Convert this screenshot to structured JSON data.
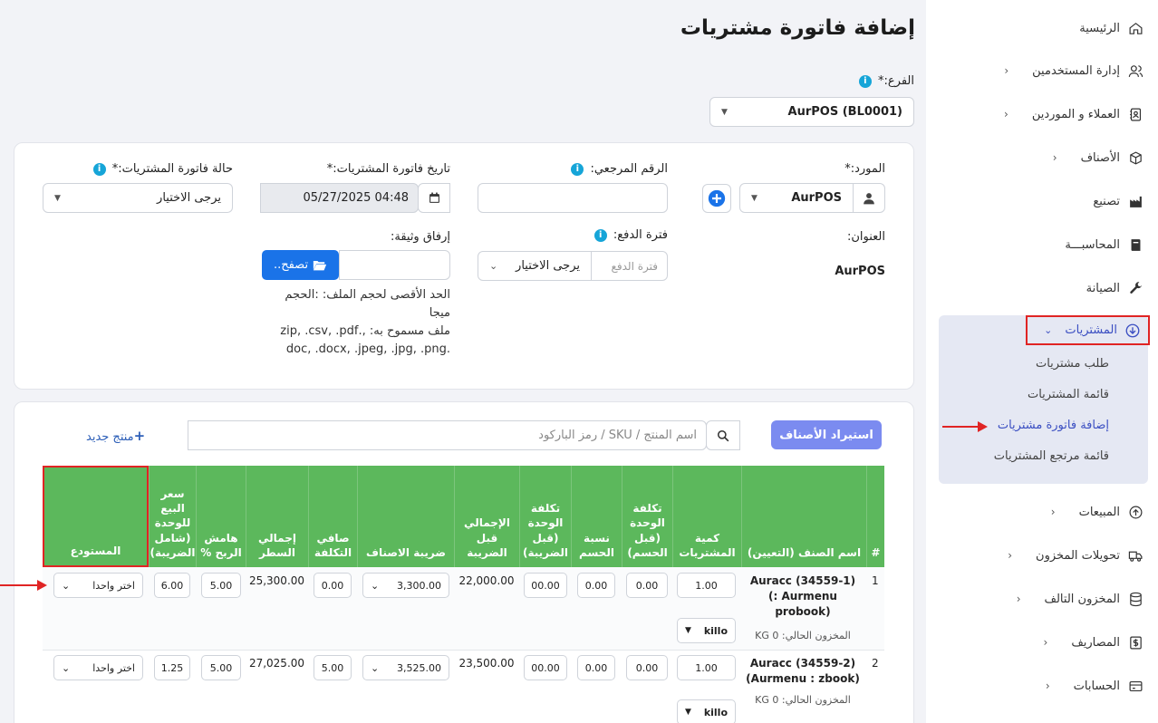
{
  "page": {
    "title": "إضافة فاتورة مشتريات"
  },
  "sidebar": {
    "items": [
      {
        "label": "الرئيسية",
        "icon": "home-icon",
        "chevron": false
      },
      {
        "label": "إدارة المستخدمين",
        "icon": "users-icon",
        "chevron": true
      },
      {
        "label": "العملاء و الموردين",
        "icon": "address-book-icon",
        "chevron": true
      },
      {
        "label": "الأصناف",
        "icon": "box-icon",
        "chevron": true
      },
      {
        "label": "تصنيع",
        "icon": "factory-icon",
        "chevron": false
      },
      {
        "label": "المحاسبـــة",
        "icon": "book-icon",
        "chevron": false
      },
      {
        "label": "الصيانة",
        "icon": "wrench-icon",
        "chevron": false
      }
    ],
    "active": {
      "label": "المشتريات",
      "icon": "download-icon"
    },
    "sub_items": [
      "طلب مشتريات",
      "قائمة المشتريات",
      "إضافة فاتورة مشتريات",
      "قائمة مرتجع المشتريات"
    ],
    "lower_items": [
      {
        "label": "المبيعات",
        "icon": "upload-icon"
      },
      {
        "label": "تحويلات المخزون",
        "icon": "truck-icon"
      },
      {
        "label": "المخزون التالف",
        "icon": "database-icon"
      },
      {
        "label": "المصاريف",
        "icon": "dollar-icon"
      },
      {
        "label": "الحسابات",
        "icon": "wallet-icon"
      }
    ]
  },
  "branch": {
    "label": "الفرع:*",
    "value": "AurPOS (BL0001)"
  },
  "form": {
    "supplier_label": "المورد:*",
    "supplier_value": "AurPOS",
    "reference_label": "الرقم المرجعي:",
    "date_label": "تاريخ فاتورة المشتريات:*",
    "date_value": "05/27/2025 04:48",
    "status_label": "حالة فاتورة المشتريات:*",
    "status_value": "يرجى الاختيار",
    "address_label": "العنوان:",
    "address_value": "AurPOS",
    "payment_term_label": "فترة الدفع:",
    "payment_term_placeholder": "فترة الدفع",
    "payment_term_select": "يرجى الاختيار",
    "attach_label": "إرفاق وثيقة:",
    "browse_label": "تصفح..",
    "file_note_1": "الحد الأقصى لحجم الملف: :الحجم",
    "file_note_2": "ميجا",
    "file_note_3": "ملف مسموح به: ,.zip, .csv, .pdf",
    "file_note_4": ".doc, .docx, .jpeg, .jpg, .png"
  },
  "products": {
    "import_label": "استيراد الأصناف",
    "search_placeholder": "اسم المنتج / SKU / رمز الباركود",
    "new_product_label": "منتج جديد"
  },
  "table": {
    "headers": {
      "num": "#",
      "name": "اسم الصنف (التعيين)",
      "qty": "كمية المشتريات",
      "unit_cost_before_disc": "تكلفة الوحدة (قبل الحسم)",
      "discount": "نسبة الحسم",
      "unit_cost_before_tax": "تكلفة الوحدة (قبل الضريبة)",
      "total_before_tax": "الإجمالي قبل الضريبة",
      "tax": "ضريبة الاصناف",
      "net_cost": "صافي التكلفة",
      "line_total": "إجمالي السطر",
      "margin": "هامش الربح %",
      "sell_price": "سعر البيع للوحدة (شامل الضريبة)",
      "warehouse": "المستودع"
    },
    "rows": [
      {
        "num": "1",
        "name_lines": [
          "Auracc (34559-1)",
          "Aurmenu :)",
          "(probook"
        ],
        "stock": "المخزون الحالي: KG 0",
        "qty": "1.00",
        "unit": "killo",
        "unit_cost": "0.00",
        "discount": "0.00",
        "unit_cost_before_tax": "00.00",
        "total_before_tax": "22,000.00",
        "tax": "3,300.00",
        "net_cost": "0.00",
        "line_total": "25,300.00",
        "margin": "5.00",
        "sell_price": "6.00",
        "warehouse": "اختر واحدا"
      },
      {
        "num": "2",
        "name_lines": [
          "Auracc (34559-2)",
          "(Aurmenu : zbook)"
        ],
        "stock": "المخزون الحالي: KG 0",
        "qty": "1.00",
        "unit": "killo",
        "unit_cost": "0.00",
        "discount": "0.00",
        "unit_cost_before_tax": "00.00",
        "total_before_tax": "23,500.00",
        "tax": "3,525.00",
        "net_cost": "5.00",
        "line_total": "27,025.00",
        "margin": "5.00",
        "sell_price": "1.25",
        "warehouse": "اختر واحدا"
      }
    ]
  },
  "colors": {
    "accent": "#3b4fc2",
    "table_header": "#5cb85c",
    "highlight": "#e02424",
    "primary_button": "#1a73e8",
    "import_button": "#7b8bf0"
  }
}
